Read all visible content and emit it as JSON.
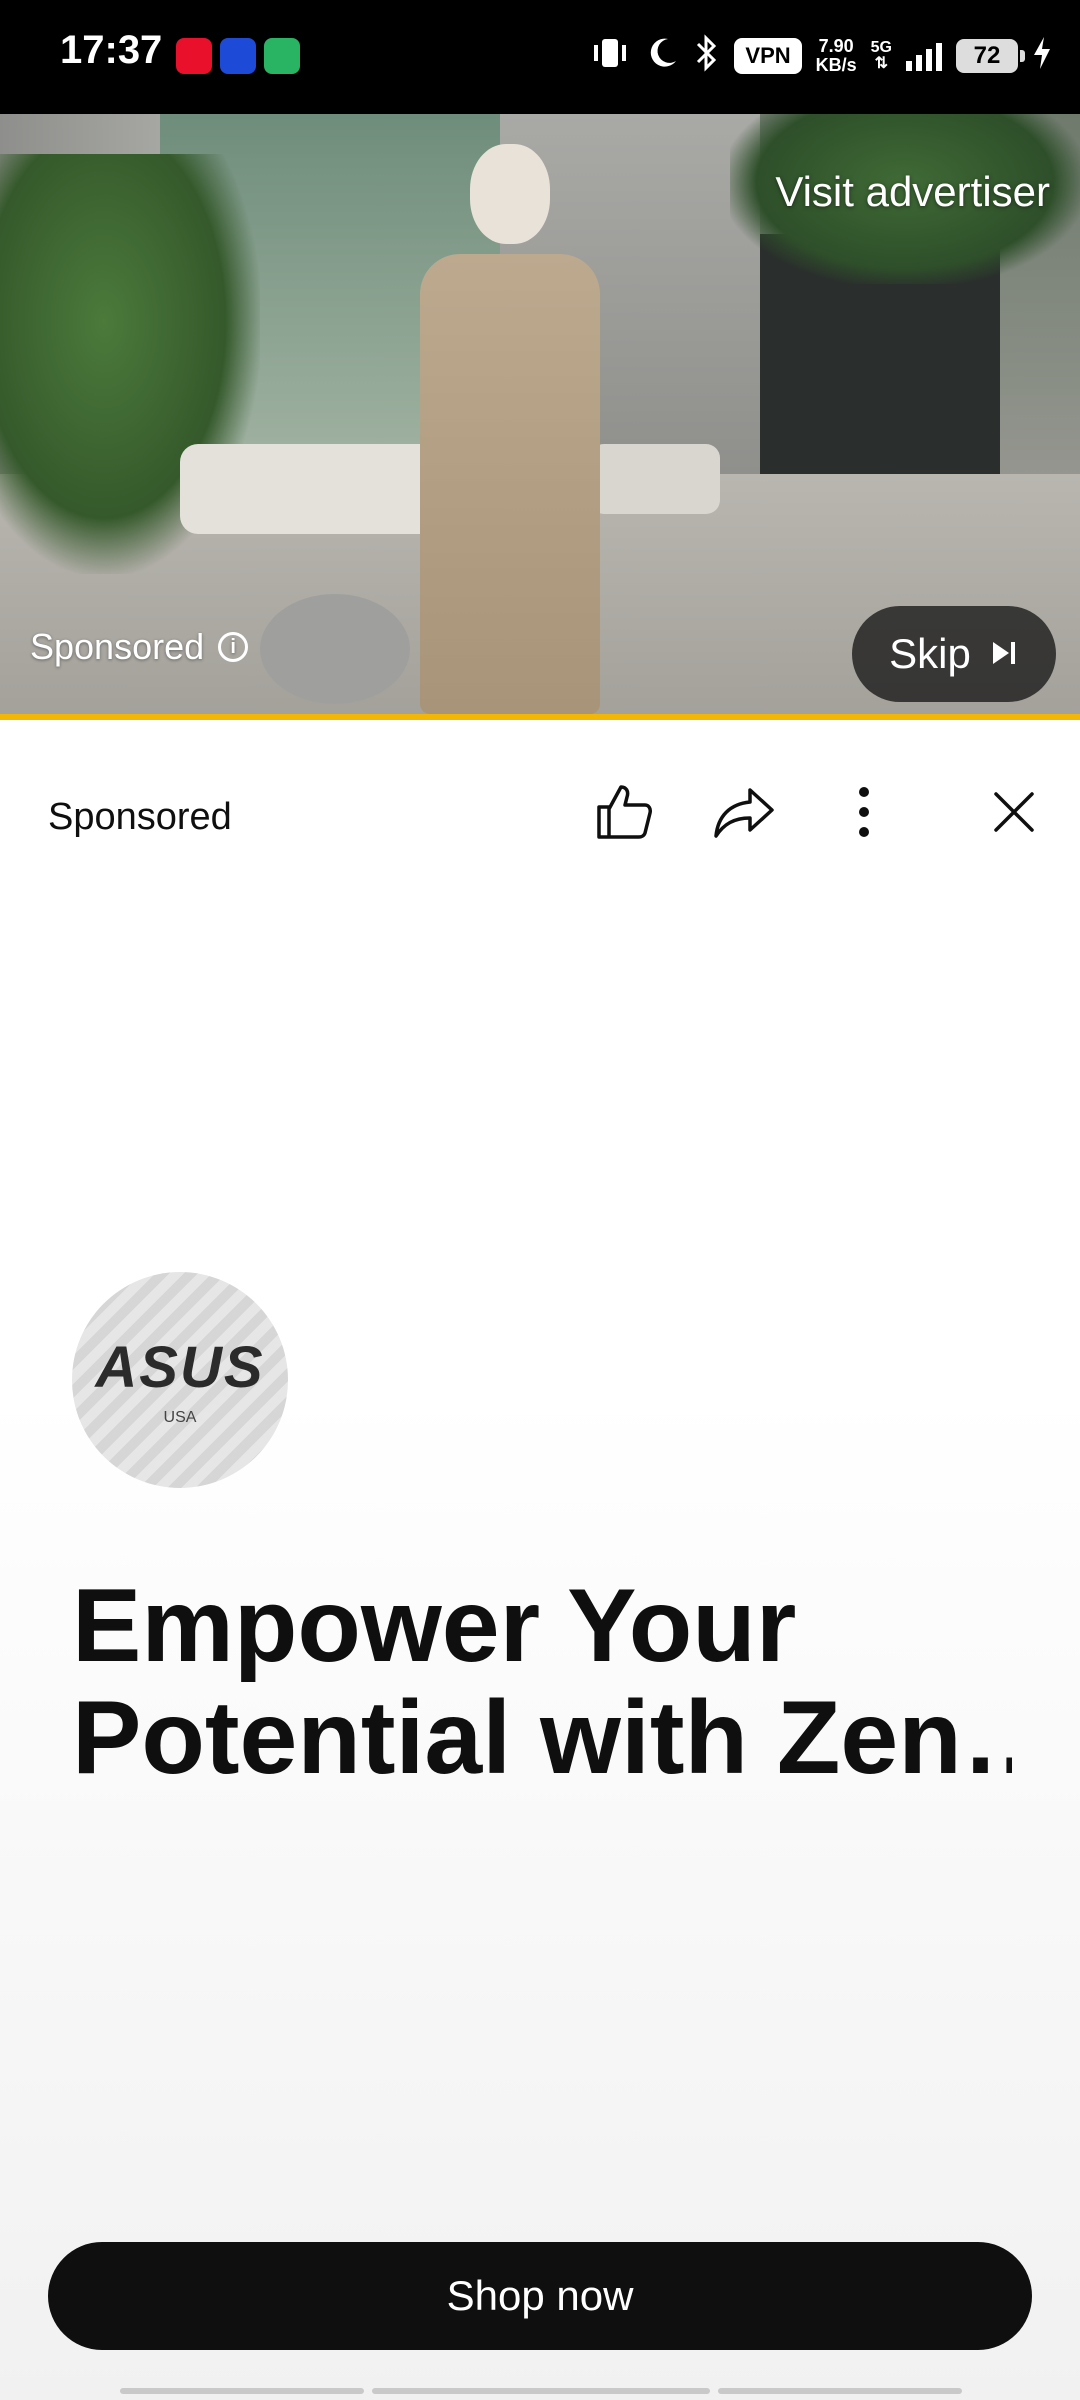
{
  "status_bar": {
    "time": "17:37",
    "vpn": "VPN",
    "speed_value": "7.90",
    "speed_unit": "KB/s",
    "network": "5G",
    "battery": "72"
  },
  "video": {
    "visit_advertiser": "Visit advertiser",
    "skip_label": "Skip",
    "sponsored_label": "Sponsored",
    "progress_fraction": 1.0,
    "colors": {
      "progress": "#f2b705"
    }
  },
  "panel": {
    "sponsored_label": "Sponsored",
    "logo_text": "ASUS",
    "logo_sub": "USA",
    "headline_line1": "Empower Your",
    "headline_line2": "Potential with Zen…",
    "cta_label": "Shop now"
  }
}
